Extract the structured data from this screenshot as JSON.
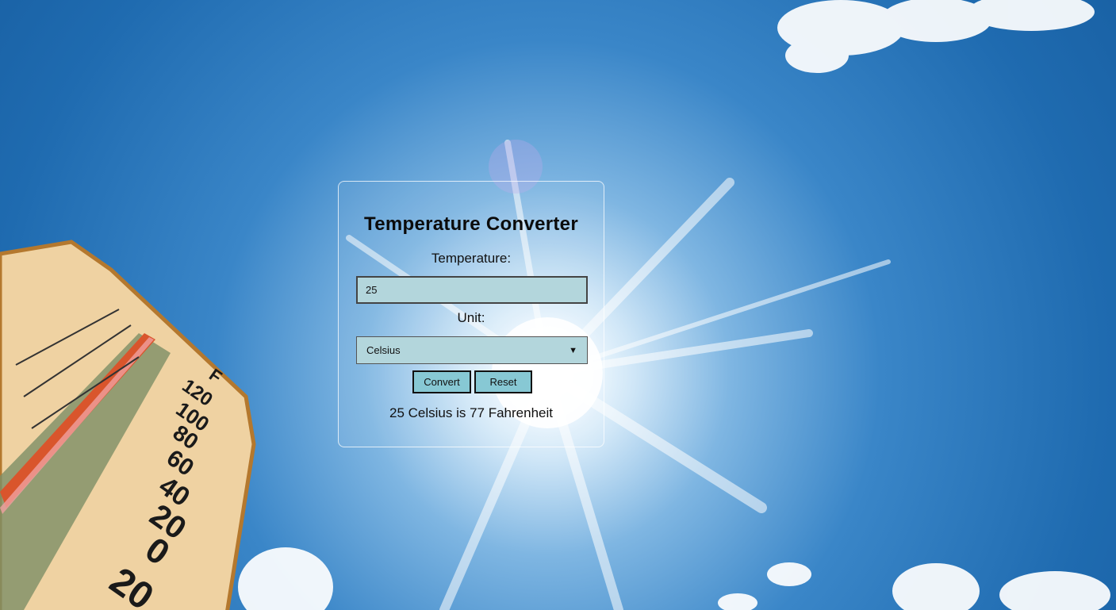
{
  "converter": {
    "title": "Temperature Converter",
    "temperature_label": "Temperature:",
    "temperature_value": "25",
    "unit_label": "Unit:",
    "unit_selected": "Celsius",
    "convert_label": "Convert",
    "reset_label": "Reset",
    "result_text": "25 Celsius is 77 Fahrenheit"
  },
  "background": {
    "thermometer_scale_labels": [
      "120",
      "100",
      "80",
      "60",
      "40",
      "20",
      "0",
      "20"
    ],
    "thermometer_unit": "F"
  },
  "colors": {
    "field_background": "#b3d6dc",
    "button_background": "#87c8d4",
    "sky": "#1f6bb0"
  }
}
